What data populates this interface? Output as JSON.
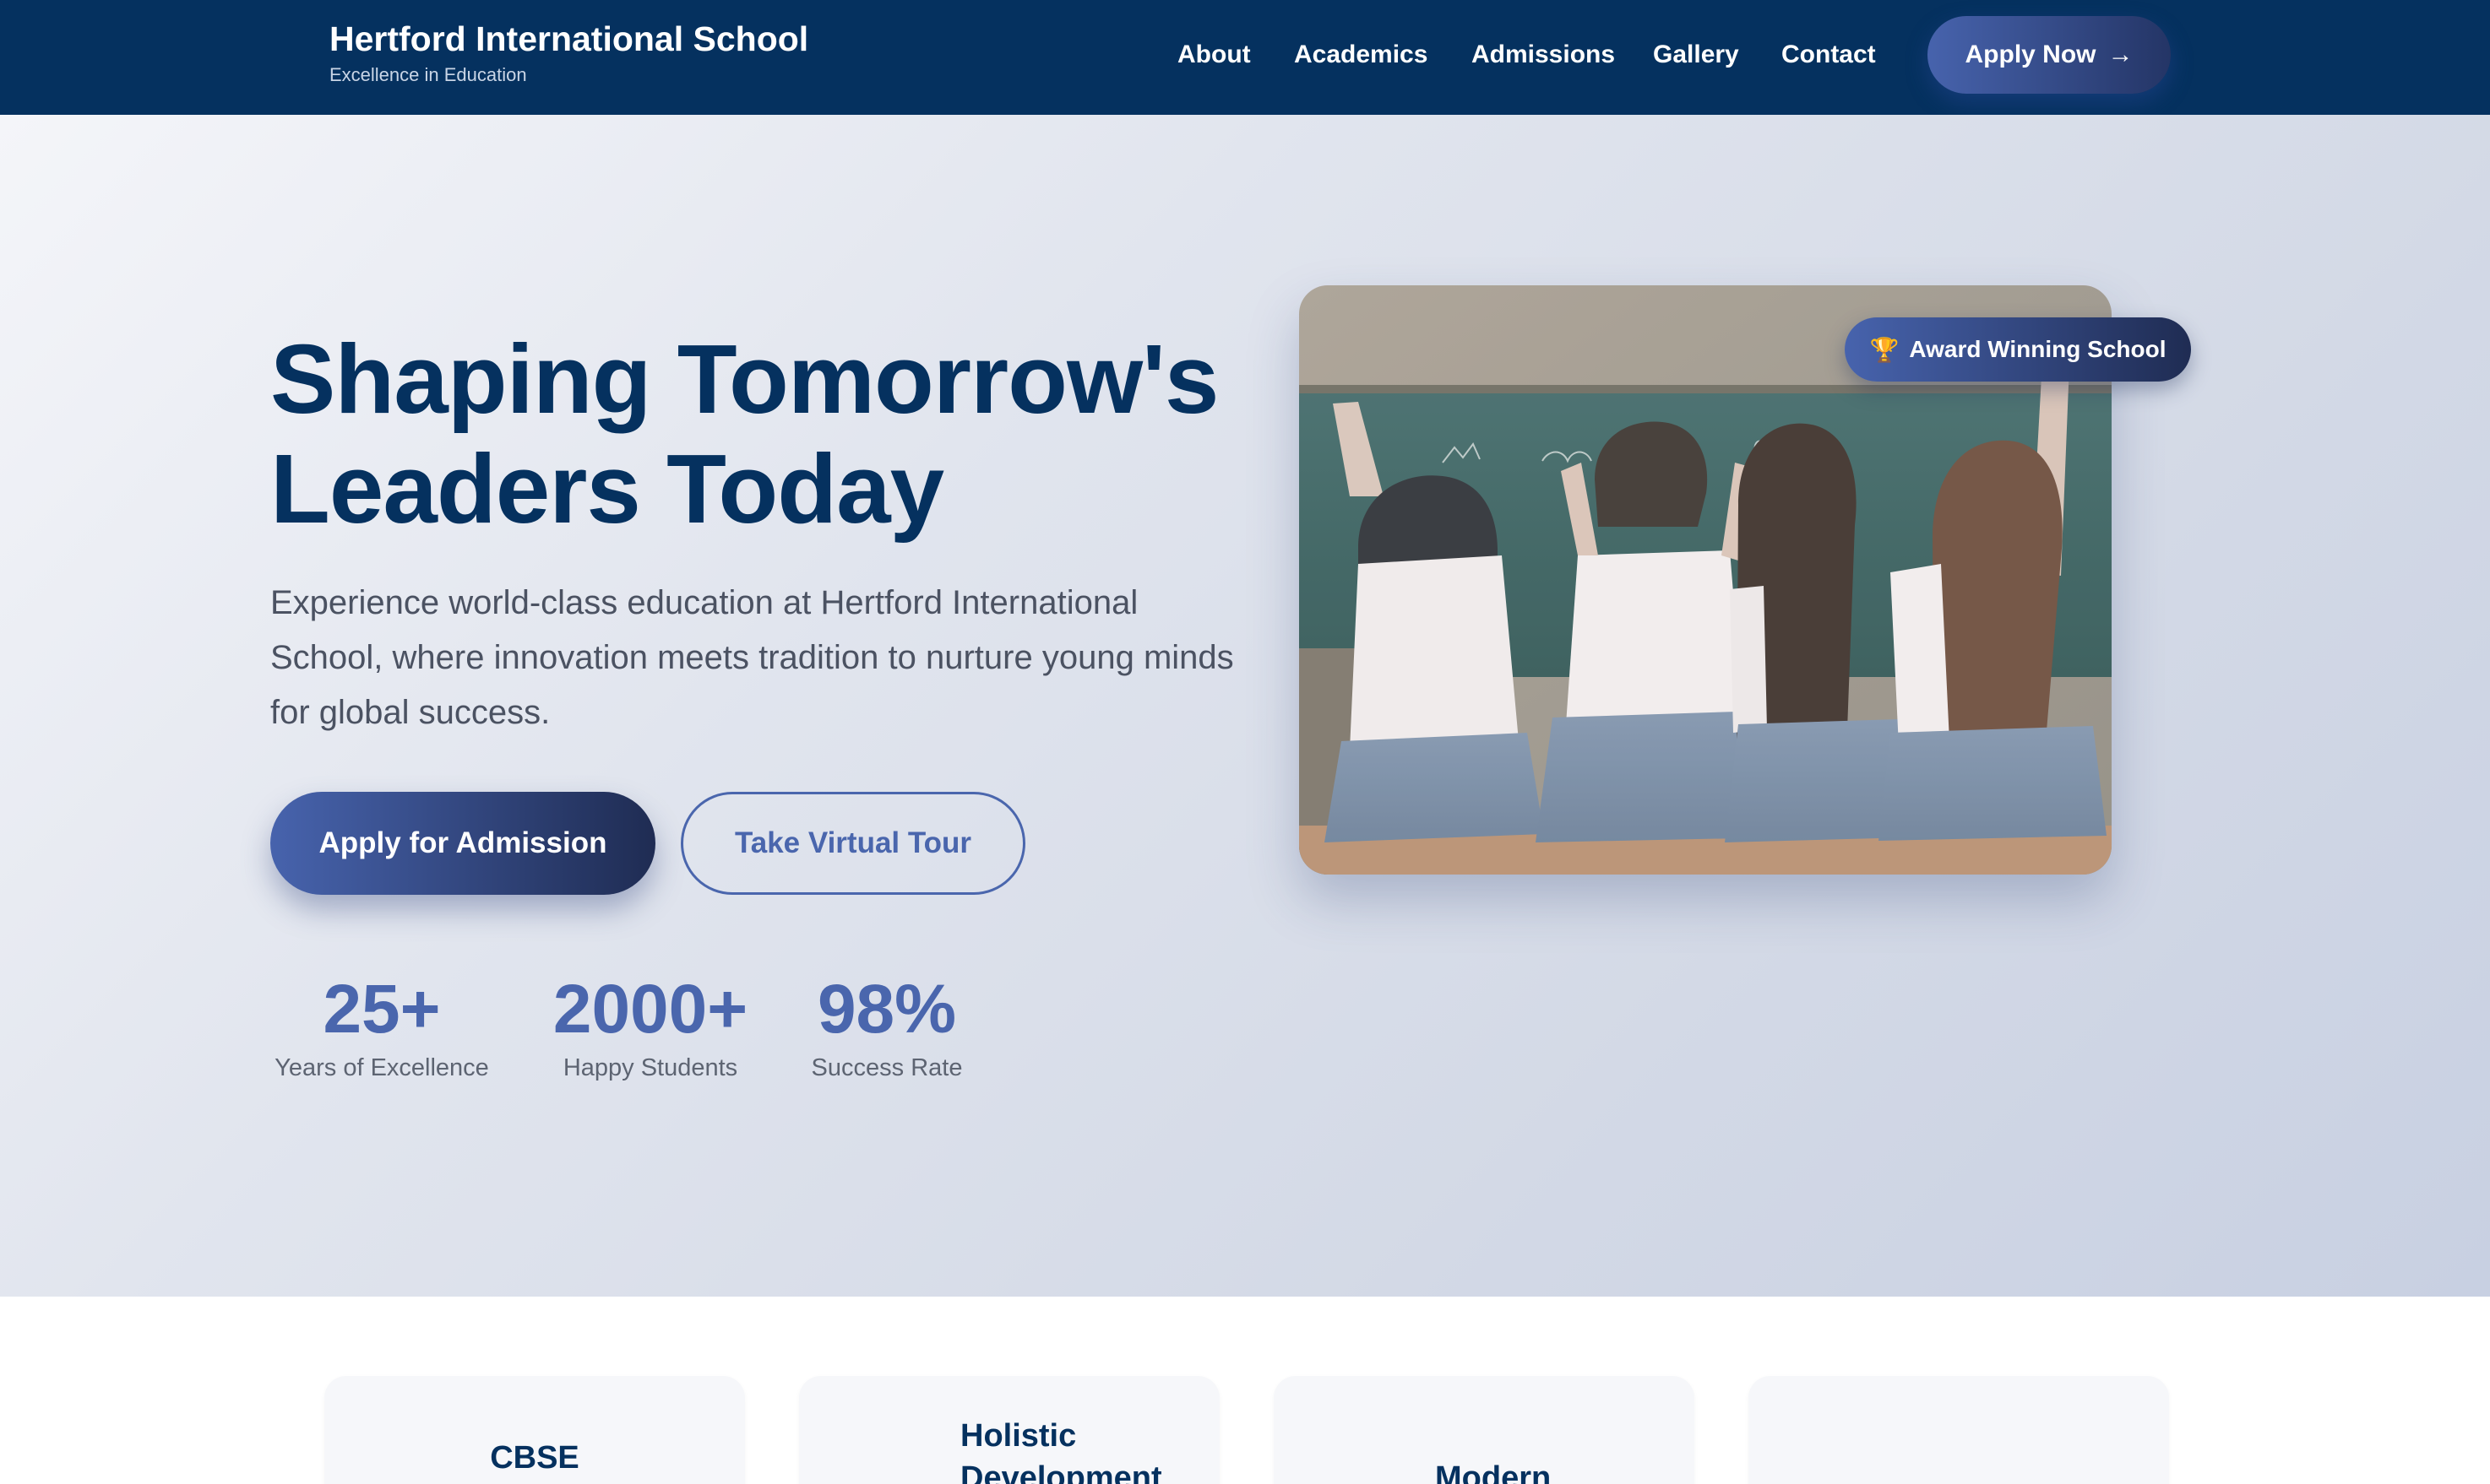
{
  "header": {
    "brand_title": "Hertford International School",
    "brand_subtitle": "Excellence in Education",
    "nav": [
      "About",
      "Academics",
      "Admissions",
      "Gallery",
      "Contact"
    ],
    "cta_label": "Apply Now",
    "cta_arrow": "→"
  },
  "hero": {
    "title_line1": "Shaping Tomorrow's",
    "title_line2": "Leaders Today",
    "description": "Experience world-class education at Hertford International School, where innovation meets tradition to nurture young minds for global success.",
    "primary_button": "Apply for Admission",
    "secondary_button": "Take Virtual Tour",
    "stats": [
      {
        "value": "25+",
        "label": "Years of Excellence"
      },
      {
        "value": "2000+",
        "label": "Happy Students"
      },
      {
        "value": "98%",
        "label": "Success Rate"
      }
    ],
    "badge_icon": "🏆",
    "badge_label": "Award Winning School",
    "photo_icon": "students-classroom-photo"
  },
  "features": {
    "cards": [
      "CBSE",
      "Holistic Development",
      "Modern",
      ""
    ]
  },
  "colors": {
    "navy": "#05315f",
    "accent": "#4a66ad",
    "button_gradient_start": "#4763ad",
    "button_gradient_end": "#1f2c53"
  }
}
